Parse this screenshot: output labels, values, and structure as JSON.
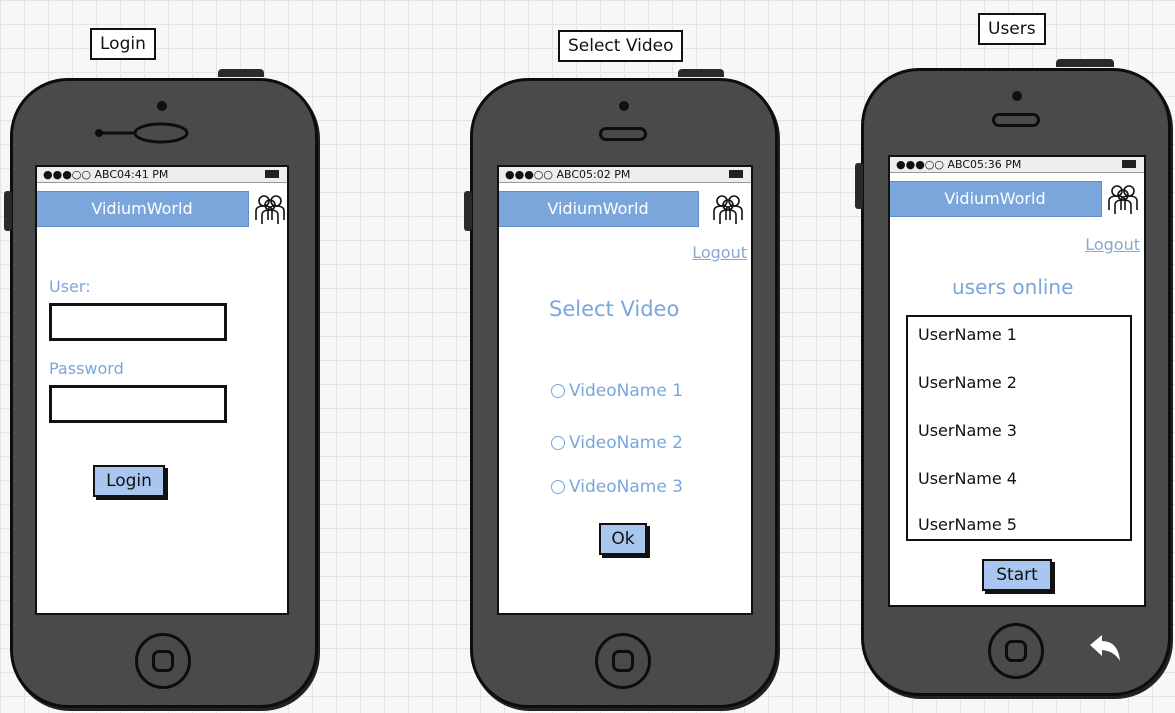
{
  "captions": {
    "login": "Login",
    "select_video": "Select Video",
    "users": "Users"
  },
  "app": {
    "title": "VidiumWorld"
  },
  "login_screen": {
    "status": "●●●○○ ABC04:41 PM",
    "user_label": "User:",
    "password_label": "Password",
    "login_button": "Login"
  },
  "select_screen": {
    "status": "●●●○○ ABC05:02 PM",
    "logout": "Logout",
    "heading": "Select Video",
    "videos": [
      "VideoName 1",
      "VideoName 2",
      "VideoName 3"
    ],
    "ok_button": "Ok"
  },
  "users_screen": {
    "status": "●●●○○ ABC05:36 PM",
    "logout": "Logout",
    "heading": "users online",
    "users": [
      "UserName 1",
      "UserName 2",
      "UserName 3",
      "UserName 4",
      "UserName 5"
    ],
    "start_button": "Start"
  },
  "icons": [
    "users-group-icon",
    "home-button-icon",
    "back-arrow-icon",
    "key-icon"
  ]
}
